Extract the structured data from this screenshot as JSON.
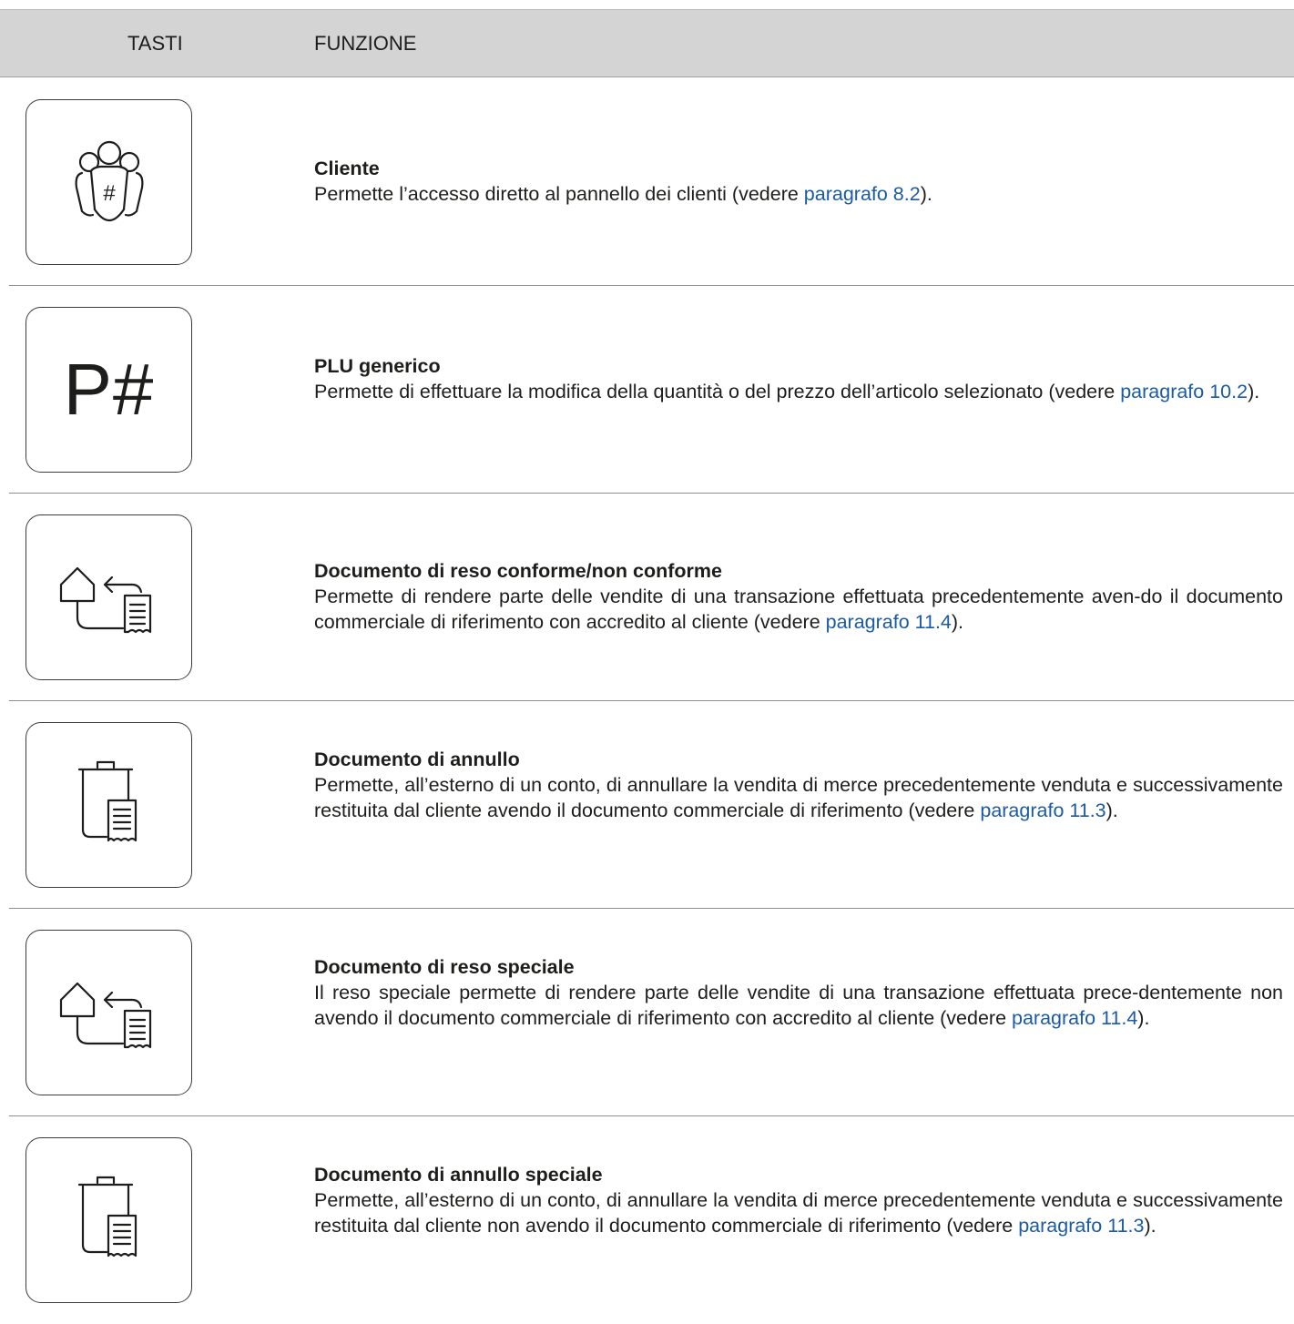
{
  "header": {
    "keys_label": "TASTI",
    "function_label": "FUNZIONE"
  },
  "colors": {
    "header_bg": "#d4d4d4",
    "link": "#1a5aa6",
    "text": "#1d1d1b"
  },
  "rows": [
    {
      "icon": "customer-group-icon",
      "title": "Cliente",
      "text_before": "Permette l’accesso diretto al pannello dei clienti (vedere ",
      "link": "paragrafo 8.2",
      "text_after": ")."
    },
    {
      "icon": "p-hash-key-icon",
      "key_text": "P#",
      "title": "PLU generico",
      "text_before": "Permette di effettuare la modifica della quantità o del prezzo dell’articolo selezionato (vedere ",
      "link": "paragrafo 10.2",
      "text_after": ")."
    },
    {
      "icon": "return-document-icon",
      "title": "Documento di reso conforme/non conforme",
      "text_before": "Permette di rendere parte delle vendite di una transazione effettuata precedentemente aven-do il documento commerciale di riferimento con accredito al cliente (vedere ",
      "link": "paragrafo 11.4",
      "text_after": ")."
    },
    {
      "icon": "void-document-icon",
      "title": "Documento di annullo",
      "text_before": "Permette, all’esterno di un conto, di annullare la vendita di merce precedentemente venduta e successivamente restituita dal cliente avendo il documento commerciale di riferimento (vedere ",
      "link": "paragrafo 11.3",
      "text_after": ")."
    },
    {
      "icon": "return-document-icon",
      "title": "Documento di reso speciale",
      "text_before": "Il reso speciale permette di rendere parte delle vendite di una transazione effettuata prece-dentemente non avendo il documento commerciale di riferimento con accredito al cliente (vedere ",
      "link": "paragrafo 11.4",
      "text_after": ")."
    },
    {
      "icon": "void-document-icon",
      "title": "Documento di annullo speciale",
      "text_before": "Permette, all’esterno di un conto, di annullare la vendita di merce precedentemente venduta e successivamente restituita dal cliente non avendo il documento commerciale di riferimento (vedere ",
      "link": "paragrafo 11.3",
      "text_after": ")."
    }
  ]
}
